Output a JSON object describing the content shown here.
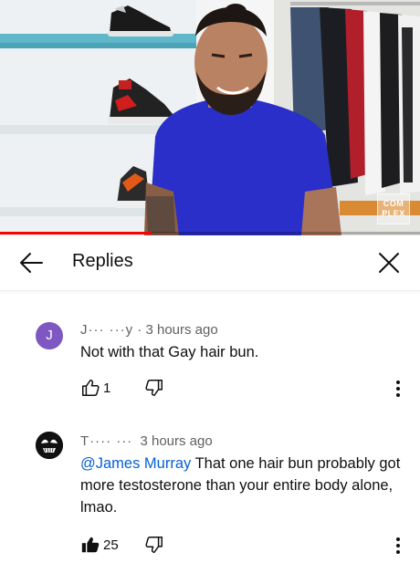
{
  "video": {
    "watermark": "COM PLEX",
    "progress": 0.36,
    "colors": {
      "accent_progress": "#ff0000",
      "shirt": "#2a2fc9"
    }
  },
  "header": {
    "back_icon": "arrow-left-icon",
    "title": "Replies",
    "close_icon": "close-icon"
  },
  "comments": [
    {
      "avatar_letter": "J",
      "avatar_color": "#7e57c2",
      "author": "J···  ···y",
      "separator": "·",
      "time": "3 hours ago",
      "text": "Not with that Gay hair bun.",
      "likes": "1",
      "like_icon": "thumbs-up-outline-icon",
      "dislike_icon": "thumbs-down-outline-icon",
      "more_icon": "more-vertical-icon"
    },
    {
      "avatar_color": "#111111",
      "author": "T···· ···",
      "time": "3 hours ago",
      "mention": "@James Murray",
      "text": " That one hair bun probably got more testosterone than your entire body alone, lmao.",
      "likes": "25",
      "like_icon": "thumbs-up-filled-icon",
      "dislike_icon": "thumbs-down-outline-icon",
      "more_icon": "more-vertical-icon"
    }
  ]
}
